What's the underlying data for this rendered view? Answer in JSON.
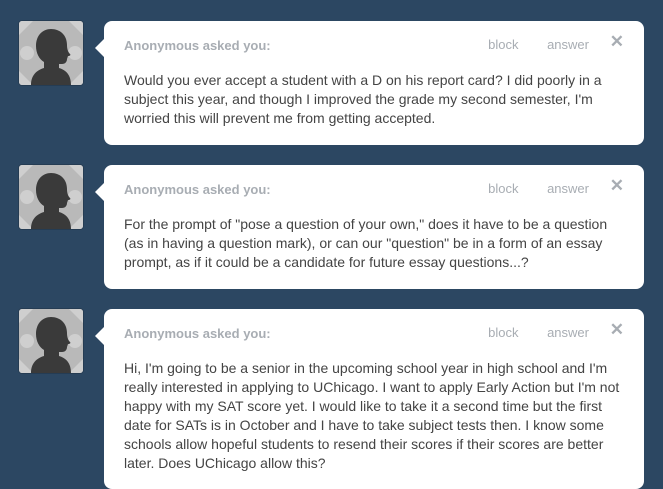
{
  "colors": {
    "background": "#2c4762",
    "card": "#ffffff",
    "meta_text": "#a8adb3",
    "body_text": "#444444"
  },
  "messages": [
    {
      "asker": "Anonymous asked you:",
      "block_label": "block",
      "answer_label": "answer",
      "close_icon": "close-icon",
      "question": "Would you ever accept a student with a D on his report card? I did poorly in a subject this year, and though I improved the grade my second semester, I'm worried this will prevent me from getting accepted."
    },
    {
      "asker": "Anonymous asked you:",
      "block_label": "block",
      "answer_label": "answer",
      "close_icon": "close-icon",
      "question": "For the prompt of \"pose a question of your own,\" does it have to be a question (as in having a question mark), or can our \"question\" be in a form of an essay prompt, as if it could be a candidate for future essay questions...?"
    },
    {
      "asker": "Anonymous asked you:",
      "block_label": "block",
      "answer_label": "answer",
      "close_icon": "close-icon",
      "question": "Hi, I'm going to be a senior in the upcoming school year in high school and I'm really interested in applying to UChicago. I want to apply Early Action but I'm not happy with my SAT score yet. I would like to take it a second time but the first date for SATs is in October and I have to take subject tests then. I know some schools allow hopeful students to resend their scores if their scores are better later. Does UChicago allow this?"
    }
  ]
}
